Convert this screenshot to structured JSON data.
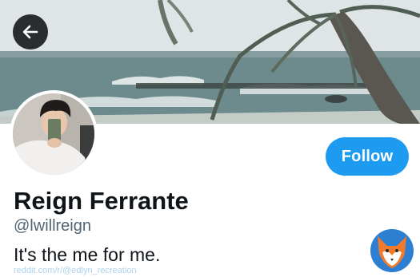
{
  "profile": {
    "name": "Reign Ferrante",
    "handle": "@lwillreign",
    "bio": "It's the me for me."
  },
  "actions": {
    "follow_label": "Follow",
    "back_icon": "arrow-left-icon"
  },
  "watermark": {
    "text": "reddit.com/r/@edlyn_recreation"
  },
  "colors": {
    "accent": "#1d9bf0",
    "name_text": "#0f1419",
    "secondary_text": "#536471",
    "back_button_bg": "#2a2d2f"
  }
}
